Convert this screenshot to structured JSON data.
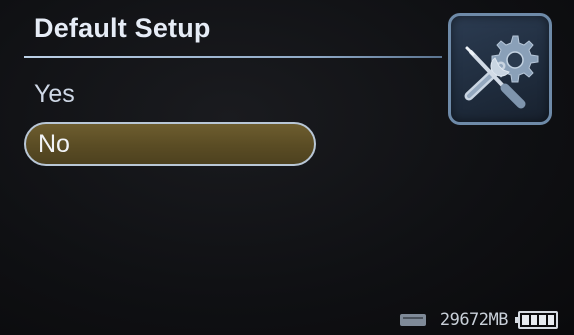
{
  "screen": {
    "title": "Default Setup",
    "options": [
      {
        "label": "Yes",
        "selected": false
      },
      {
        "label": "No",
        "selected": true
      }
    ],
    "icon": "settings-wrench-gear-icon"
  },
  "status": {
    "storage_icon": "sd-card-icon",
    "capacity": "29672MB",
    "battery_icon": "battery-icon",
    "battery_level": 1.0
  },
  "colors": {
    "selected_fill": "#5a4c24",
    "selected_border": "#b9c7d6",
    "tile_border": "#6e8aa8",
    "text": "#e6ecf6"
  }
}
